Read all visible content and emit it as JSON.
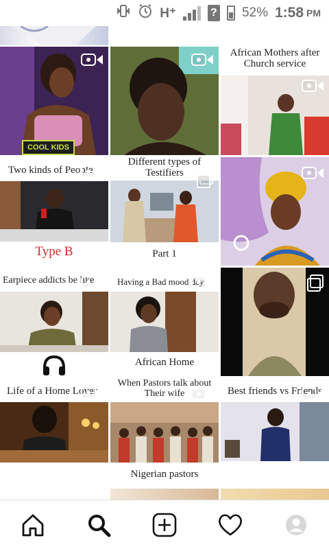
{
  "status_bar": {
    "net": "H⁺",
    "battery_pct": "52%",
    "time": "1:58",
    "ampm": "PM",
    "signal_level": 0.75,
    "battery_level": 0.52
  },
  "grid": {
    "tiles": [
      {
        "caption": "",
        "bottom_caption": "",
        "badge": "",
        "kind": "cut-top"
      },
      {
        "caption": "",
        "bottom_caption": "",
        "badge": "",
        "kind": "cut-top"
      },
      {
        "caption": "",
        "bottom_caption": "",
        "badge": "COOL KIDS",
        "kind": "video"
      },
      {
        "caption": "",
        "bottom_caption": "",
        "badge": "",
        "kind": "video"
      },
      {
        "caption": "African Mothers after Church service",
        "bottom_caption": "",
        "badge": "",
        "kind": "video"
      },
      {
        "caption": "Two kinds of People",
        "bottom_caption": "Type B",
        "badge": "",
        "kind": "video"
      },
      {
        "caption": "Different types of Testifiers",
        "bottom_caption": "Part 1",
        "badge": "",
        "kind": "multi"
      },
      {
        "caption": "",
        "bottom_caption": "",
        "badge": "",
        "kind": "video"
      },
      {
        "caption": "Earpiece addicts be like",
        "bottom_caption": "",
        "badge": "",
        "kind": "video"
      },
      {
        "caption": "Having a Bad mood day",
        "bottom_caption": "African  Home",
        "badge": "",
        "kind": "video"
      },
      {
        "caption": "",
        "bottom_caption": "",
        "badge": "",
        "kind": "multi"
      },
      {
        "caption": "Life of a Home Lover",
        "bottom_caption": "",
        "badge": "",
        "kind": "video"
      },
      {
        "caption": "When Pastors talk about Their wife",
        "bottom_caption": "Nigerian pastors",
        "badge": "",
        "kind": "video"
      },
      {
        "caption": "Best friends vs Friends",
        "bottom_caption": "",
        "badge": "",
        "kind": "video"
      }
    ]
  },
  "nav": {
    "items": [
      {
        "name": "home",
        "icon": "home-icon"
      },
      {
        "name": "search",
        "icon": "search-icon"
      },
      {
        "name": "new-post",
        "icon": "plus-square-icon"
      },
      {
        "name": "activity",
        "icon": "heart-icon"
      },
      {
        "name": "profile",
        "icon": "avatar-icon"
      }
    ]
  },
  "colors": {
    "type_b_red": "#d42a2a",
    "icon_gray": "#6b6b6b"
  }
}
